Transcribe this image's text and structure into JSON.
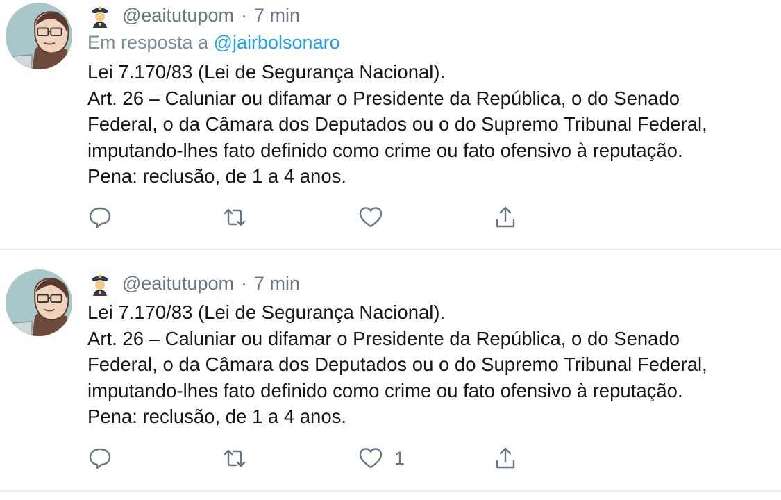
{
  "tweets": [
    {
      "handle": "@eaitutupom",
      "separator": "·",
      "time": "7 min",
      "reply_prefix": "Em resposta a",
      "reply_to": "@jairbolsonaro",
      "lines": [
        "Lei 7.170/83 (Lei de Segurança Nacional).",
        "Art. 26 – Caluniar ou difamar o Presidente da República, o do Senado",
        "Federal, o da Câmara dos Deputados ou o do Supremo Tribunal Federal,",
        "imputando-lhes fato definido como crime ou fato ofensivo à reputação.",
        "Pena: reclusão, de 1 a 4 anos."
      ],
      "actions": {
        "reply_icon": "reply-icon",
        "retweet_icon": "retweet-icon",
        "like_icon": "heart-icon",
        "share_icon": "share-icon"
      }
    },
    {
      "handle": "@eaitutupom",
      "separator": "·",
      "time": "7 min",
      "lines": [
        "Lei 7.170/83 (Lei de Segurança Nacional).",
        "Art. 26 – Caluniar ou difamar o Presidente da República, o do Senado",
        "Federal, o da Câmara dos Deputados ou o do Supremo Tribunal Federal,",
        "imputando-lhes fato definido como crime ou fato ofensivo à reputação.",
        "Pena: reclusão, de 1 a 4 anos."
      ],
      "like_count": "1",
      "actions": {
        "reply_icon": "reply-icon",
        "retweet_icon": "retweet-icon",
        "like_icon": "heart-icon",
        "share_icon": "share-icon"
      }
    }
  ],
  "colors": {
    "meta": "#657786",
    "mention": "#1da1f2",
    "text": "#14171a",
    "divider": "#e6ecf0"
  }
}
